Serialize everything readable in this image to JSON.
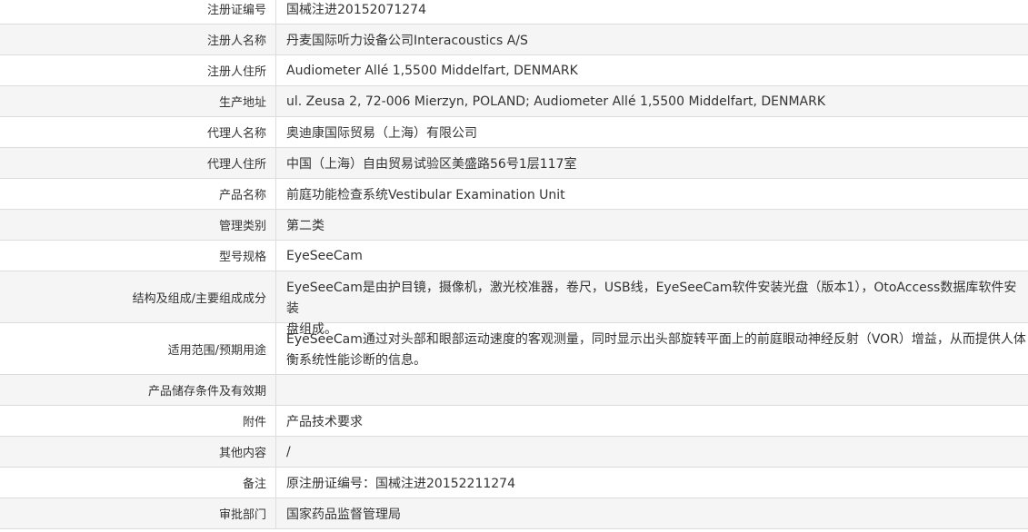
{
  "rows": [
    {
      "label": "注册证编号",
      "value": "国械注进20152071274"
    },
    {
      "label": "注册人名称",
      "value": "丹麦国际听力设备公司Interacoustics A/S"
    },
    {
      "label": "注册人住所",
      "value": "Audiometer Allé 1,5500 Middelfart, DENMARK"
    },
    {
      "label": "生产地址",
      "value": "ul. Zeusa 2, 72-006 Mierzyn, POLAND; Audiometer Allé 1,5500 Middelfart, DENMARK"
    },
    {
      "label": "代理人名称",
      "value": "奥迪康国际贸易（上海）有限公司"
    },
    {
      "label": "代理人住所",
      "value": "中国（上海）自由贸易试验区美盛路56号1层117室"
    },
    {
      "label": "产品名称",
      "value": "前庭功能检查系统Vestibular Examination Unit"
    },
    {
      "label": "管理类别",
      "value": "第二类"
    },
    {
      "label": "型号规格",
      "value": "EyeSeeCam"
    },
    {
      "label": "结构及组成/主要组成成分",
      "value": "EyeSeeCam是由护目镜，摄像机，激光校准器，卷尺，USB线，EyeSeeCam软件安装光盘（版本1），OtoAccess数据库软件安装",
      "value2": "盘组成。"
    },
    {
      "label": "适用范围/预期用途",
      "value": "EyeSeeCam通过对头部和眼部运动速度的客观测量，同时显示出头部旋转平面上的前庭眼动神经反射（VOR）增益，从而提供人体",
      "value2": "衡系统性能诊断的信息。"
    },
    {
      "label": "产品储存条件及有效期",
      "value": ""
    },
    {
      "label": "附件",
      "value": "产品技术要求"
    },
    {
      "label": "其他内容",
      "value": "/"
    },
    {
      "label": "备注",
      "value": "原注册证编号：国械注进20152211274"
    },
    {
      "label": "审批部门",
      "value": "国家药品监督管理局"
    }
  ]
}
